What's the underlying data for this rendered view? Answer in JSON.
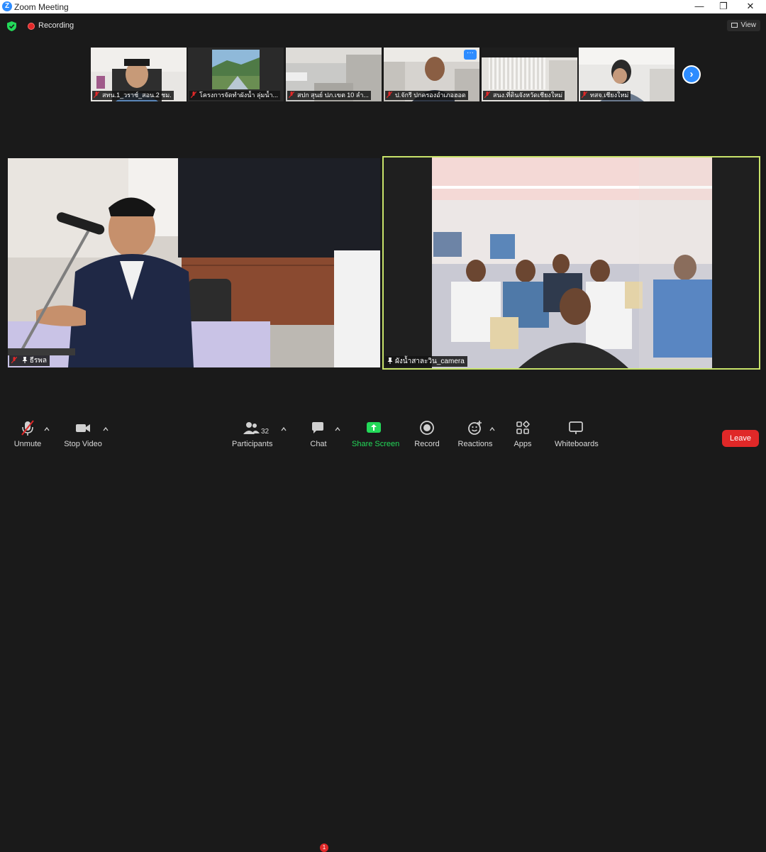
{
  "window": {
    "title": "Zoom Meeting",
    "minimize": "—",
    "restore": "❐",
    "close": "✕"
  },
  "status": {
    "recording_label": "Recording",
    "view_label": "View"
  },
  "thumbnails": [
    {
      "name": "สทน.1_วราช์_สอน.2 ชม."
    },
    {
      "name": "โครงการจัดทำผังน้ำ ลุ่มน้ำ..."
    },
    {
      "name": "สปก สุนย์ ปภ.เขต 10 ลำ..."
    },
    {
      "name": "ป.จักรี ปกครองอำเภอฮอด"
    },
    {
      "name": "สนง.ที่ดินจังหวัดเชียงใหม่"
    },
    {
      "name": "ทสจ.เชียงใหม่"
    }
  ],
  "main_videos": {
    "left_name": "ธีรพล",
    "right_name": "ผังน้ำสาละวิน_camera"
  },
  "toolbar": {
    "unmute": "Unmute",
    "stop_video": "Stop Video",
    "participants": "Participants",
    "participants_count": "32",
    "chat": "Chat",
    "chat_badge": "1",
    "share_screen": "Share Screen",
    "record": "Record",
    "reactions": "Reactions",
    "apps": "Apps",
    "whiteboards": "Whiteboards",
    "leave": "Leave"
  },
  "colors": {
    "accent": "#2d8cff",
    "share_green": "#23d959",
    "leave_red": "#e02828",
    "active_speaker_border": "#c8e36a"
  }
}
